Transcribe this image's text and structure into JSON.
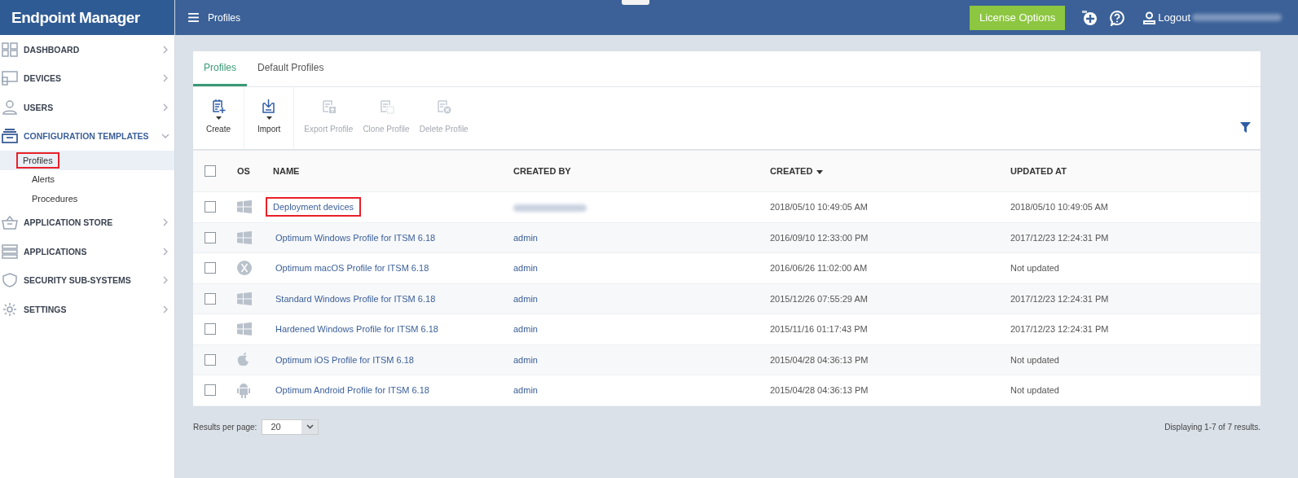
{
  "app": {
    "title": "Endpoint Manager"
  },
  "header": {
    "page_title": "Profiles",
    "license_button": "License Options",
    "logout": "Logout",
    "user_redacted": true
  },
  "sidebar": {
    "items": [
      {
        "label": "DASHBOARD",
        "expanded": false
      },
      {
        "label": "DEVICES",
        "expanded": false
      },
      {
        "label": "USERS",
        "expanded": false
      },
      {
        "label": "CONFIGURATION TEMPLATES",
        "expanded": true,
        "children": [
          {
            "label": "Profiles",
            "selected": true,
            "highlighted": true
          },
          {
            "label": "Alerts",
            "selected": false,
            "highlighted": false
          },
          {
            "label": "Procedures",
            "selected": false,
            "highlighted": false
          }
        ]
      },
      {
        "label": "APPLICATION STORE",
        "expanded": false
      },
      {
        "label": "APPLICATIONS",
        "expanded": false
      },
      {
        "label": "SECURITY SUB-SYSTEMS",
        "expanded": false
      },
      {
        "label": "SETTINGS",
        "expanded": false
      }
    ]
  },
  "tabs": [
    {
      "label": "Profiles",
      "selected": true
    },
    {
      "label": "Default Profiles",
      "selected": false
    }
  ],
  "toolbar": [
    {
      "label": "Create",
      "kind": "create",
      "disabled": false,
      "dropdown": true
    },
    {
      "label": "Import",
      "kind": "import",
      "disabled": false,
      "dropdown": true
    },
    {
      "label": "Export Profile",
      "kind": "export",
      "disabled": true,
      "dropdown": false
    },
    {
      "label": "Clone Profile",
      "kind": "clone",
      "disabled": true,
      "dropdown": false
    },
    {
      "label": "Delete Profile",
      "kind": "delete",
      "disabled": true,
      "dropdown": false
    }
  ],
  "table": {
    "select_all_checked": false,
    "columns": [
      {
        "label": "OS",
        "sorted": false
      },
      {
        "label": "NAME",
        "sorted": false
      },
      {
        "label": "CREATED BY",
        "sorted": false
      },
      {
        "label": "CREATED",
        "sorted": true
      },
      {
        "label": "UPDATED AT",
        "sorted": false
      }
    ],
    "rows": [
      {
        "kind": "windows",
        "name": "Deployment devices",
        "highlighted": true,
        "created_by_redacted": true,
        "created": "2018/05/10 10:49:05 AM",
        "updated": "2018/05/10 10:49:05 AM",
        "checked": false
      },
      {
        "kind": "windows",
        "name": "Optimum Windows Profile for ITSM 6.18",
        "highlighted": false,
        "created_by": "admin",
        "created": "2016/09/10 12:33:00 PM",
        "updated": "2017/12/23 12:24:31 PM",
        "checked": false
      },
      {
        "kind": "macos",
        "name": "Optimum macOS Profile for ITSM 6.18",
        "highlighted": false,
        "created_by": "admin",
        "created": "2016/06/26 11:02:00 AM",
        "updated": "Not updated",
        "checked": false
      },
      {
        "kind": "windows",
        "name": "Standard Windows Profile for ITSM 6.18",
        "highlighted": false,
        "created_by": "admin",
        "created": "2015/12/26 07:55:29 AM",
        "updated": "2017/12/23 12:24:31 PM",
        "checked": false
      },
      {
        "kind": "windows",
        "name": "Hardened Windows Profile for ITSM 6.18",
        "highlighted": false,
        "created_by": "admin",
        "created": "2015/11/16 01:17:43 PM",
        "updated": "2017/12/23 12:24:31 PM",
        "checked": false
      },
      {
        "kind": "ios",
        "name": "Optimum iOS Profile for ITSM 6.18",
        "highlighted": false,
        "created_by": "admin",
        "created": "2015/04/28 04:36:13 PM",
        "updated": "Not updated",
        "checked": false
      },
      {
        "kind": "android",
        "name": "Optimum Android Profile for ITSM 6.18",
        "highlighted": false,
        "created_by": "admin",
        "created": "2015/04/28 04:36:13 PM",
        "updated": "Not updated",
        "checked": false
      }
    ]
  },
  "footer": {
    "per_page_label": "Results per page:",
    "per_page": "20",
    "summary": "Displaying 1-7 of 7 results."
  }
}
